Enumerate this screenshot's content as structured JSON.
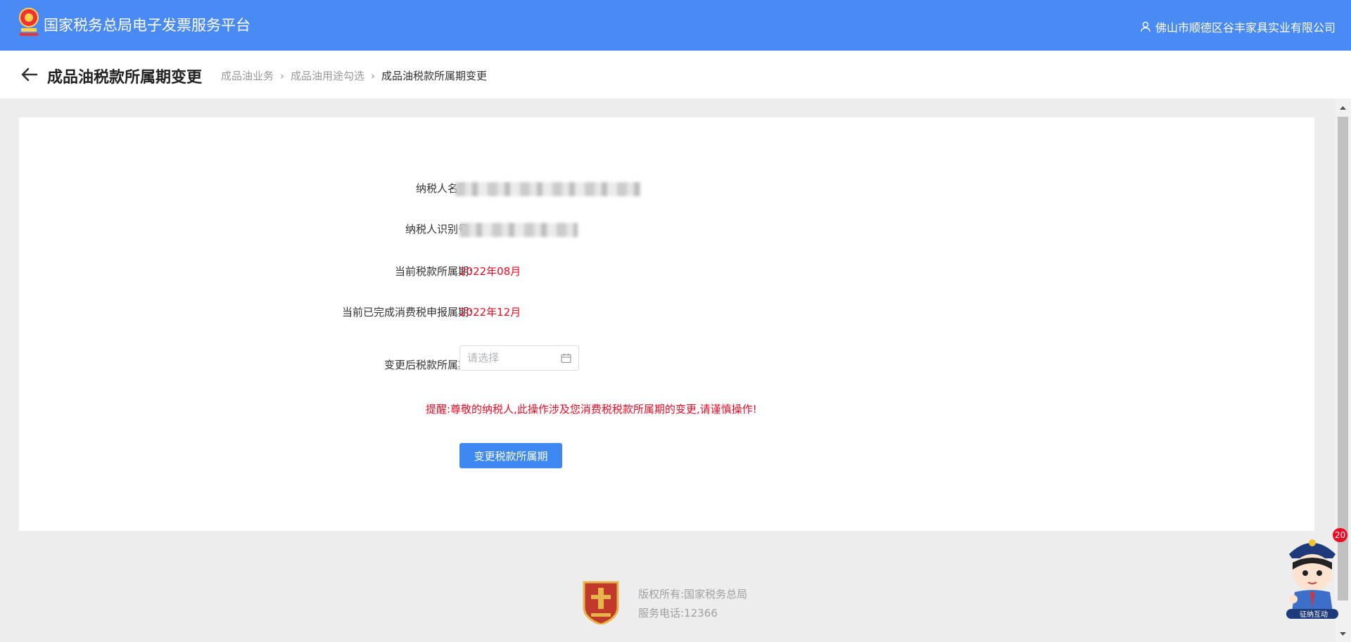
{
  "header": {
    "app_title": "国家税务总局电子发票服务平台",
    "user_name": "佛山市顺德区谷丰家具实业有限公司"
  },
  "page": {
    "title": "成品油税款所属期变更",
    "breadcrumbs": [
      "成品油业务",
      "成品油用途勾选",
      "成品油税款所属期变更"
    ]
  },
  "form": {
    "taxpayer_name_label": "纳税人名称:",
    "taxpayer_id_label": "纳税人识别号:",
    "current_period_label": "当前税款所属期:",
    "current_period_value": "2022年08月",
    "completed_period_label": "当前已完成消费税申报属期:",
    "completed_period_value": "2022年12月",
    "new_period_label": "变更后税款所属期:",
    "new_period_placeholder": "请选择",
    "tip": "提醒:尊敬的纳税人,此操作涉及您消费税税款所属期的变更,请谨慎操作!",
    "submit_label": "变更税款所属期"
  },
  "footer": {
    "copyright": "版权所有:国家税务总局",
    "phone": "服务电话:12366"
  },
  "assistant": {
    "badge_count": "20",
    "label": "征纳互动"
  },
  "colors": {
    "header_bg": "#4a8af4",
    "primary": "#3d88f2",
    "danger": "#ee0a24"
  }
}
